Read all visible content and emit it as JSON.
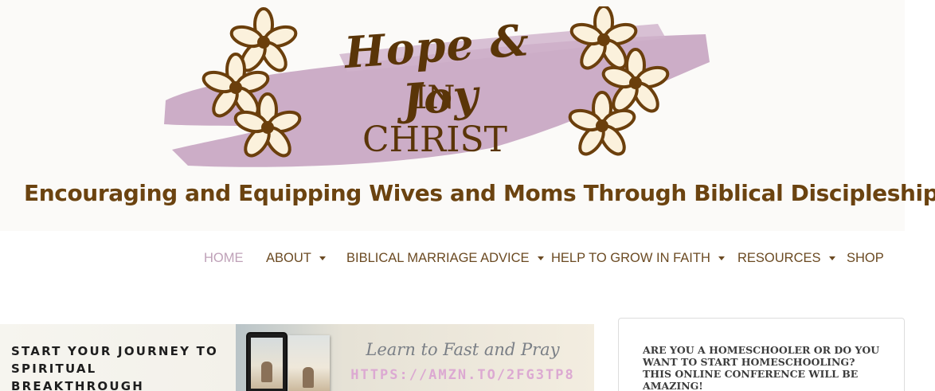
{
  "site": {
    "logo": {
      "script_text": "Hope & Joy",
      "line2": "IN",
      "line3": "CHRIST"
    },
    "tagline": "Encouraging and Equipping Wives and Moms Through Biblical Discipleship"
  },
  "nav": {
    "items": [
      {
        "label": "HOME",
        "active": true,
        "dropdown": false
      },
      {
        "label": "ABOUT",
        "active": false,
        "dropdown": true
      },
      {
        "label": "BIBLICAL MARRIAGE ADVICE",
        "active": false,
        "dropdown": true
      },
      {
        "label": "HELP TO GROW IN FAITH",
        "active": false,
        "dropdown": true
      },
      {
        "label": "RESOURCES",
        "active": false,
        "dropdown": true
      },
      {
        "label": "SHOP",
        "active": false,
        "dropdown": false
      }
    ]
  },
  "banner": {
    "headline": "START YOUR JOURNEY TO SPIRITUAL BREAKTHROUGH",
    "subhead": "Learn to Fast and Pray",
    "url": "HTTPS://AMZN.TO/2FG3TP8",
    "book_icon": "book-cover-image"
  },
  "sidebar": {
    "widget_text": "ARE YOU A HOMESCHOOLER OR DO YOU WANT TO START HOMESCHOOLING? THIS ONLINE CONFERENCE WILL BE AMAZING!"
  },
  "colors": {
    "brand_brown": "#6b4310",
    "logo_brown": "#5a3508",
    "brushstroke_lilac": "#c9a9c4",
    "nav_active": "#bfa1b8",
    "url_pink": "#dca9d2"
  }
}
